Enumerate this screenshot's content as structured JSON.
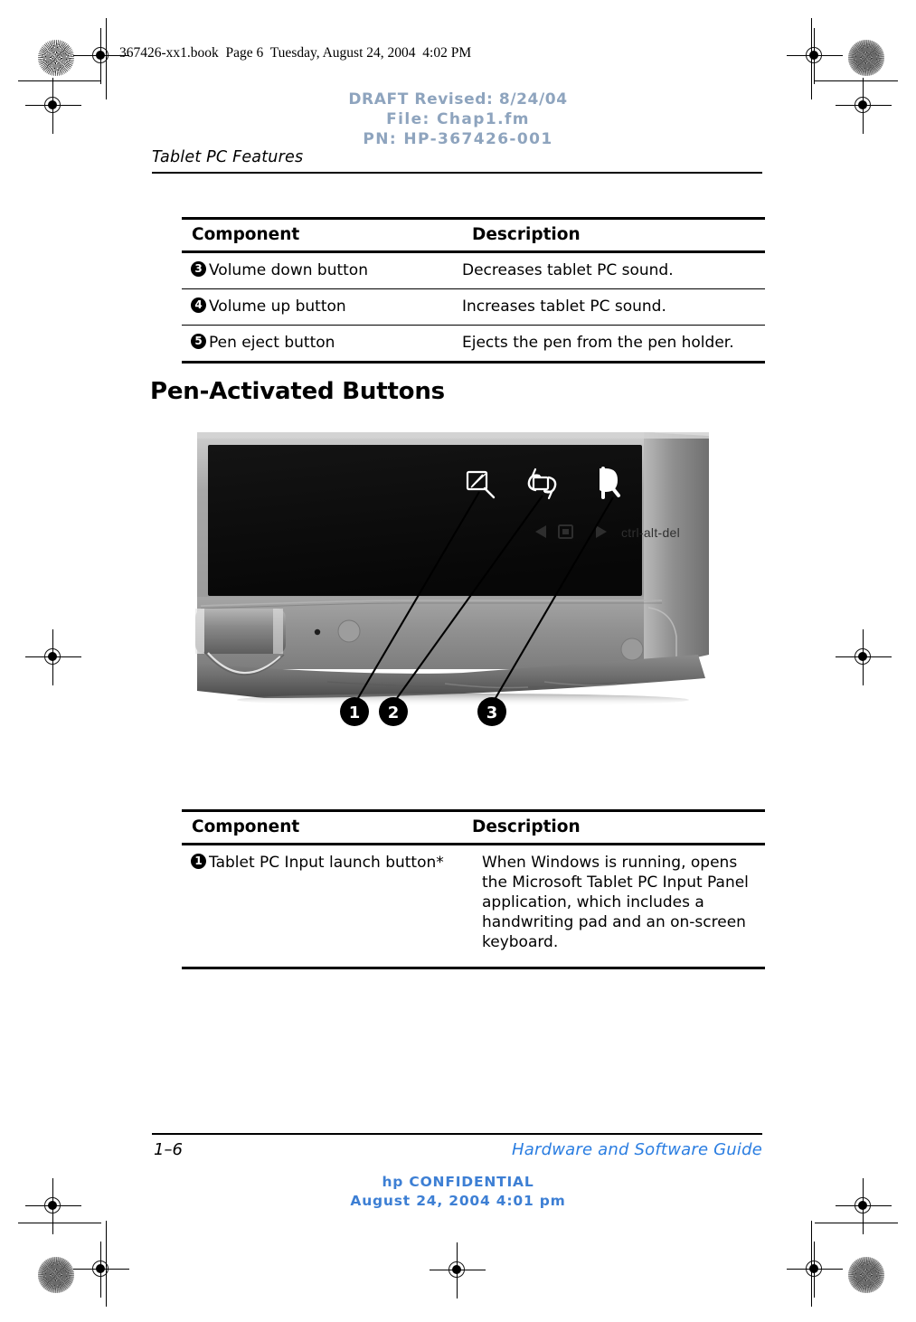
{
  "print_slug": "367426-xx1.book  Page 6  Tuesday, August 24, 2004  4:02 PM",
  "draft_header": {
    "line1": "DRAFT Revised: 8/24/04",
    "line2": "File: Chap1.fm",
    "line3": "PN: HP-367426-001",
    "color": "#8ea4be"
  },
  "running_head": "Tablet PC Features",
  "table_top": {
    "headers": {
      "component": "Component",
      "description": "Description"
    },
    "rows": [
      {
        "num": "3",
        "component": "Volume down button",
        "description": "Decreases tablet PC sound."
      },
      {
        "num": "4",
        "component": "Volume up button",
        "description": "Increases tablet PC sound."
      },
      {
        "num": "5",
        "component": "Pen eject button",
        "description": "Ejects the pen from the pen holder."
      }
    ]
  },
  "section_heading": "Pen-Activated Buttons",
  "figure": {
    "alt": "Front-edge view of tablet PC showing three pen-activated buttons",
    "ctrl_alt_del_label": "ctrl-alt-del",
    "callouts": [
      {
        "num": "1",
        "icon": "tablet-input-icon"
      },
      {
        "num": "2",
        "icon": "rotate-screen-icon"
      },
      {
        "num": "3",
        "icon": "q-menu-icon"
      }
    ],
    "nav_icons": [
      "left-arrow-icon",
      "enter-square-icon",
      "right-arrow-icon"
    ]
  },
  "table_bottom": {
    "headers": {
      "component": "Component",
      "description": "Description"
    },
    "rows": [
      {
        "num": "1",
        "component": "Tablet PC Input launch button*",
        "description": "When Windows is running, opens the Microsoft Tablet PC Input Panel application, which includes a handwriting pad and an on-screen keyboard."
      }
    ]
  },
  "footer": {
    "page_number": "1–6",
    "guide_title": "Hardware and Software Guide",
    "guide_color": "#2a7de1",
    "confidential_line1": "hp CONFIDENTIAL",
    "confidential_line2": "August 24, 2004 4:01 pm",
    "confidential_color": "#3d7fd4"
  }
}
